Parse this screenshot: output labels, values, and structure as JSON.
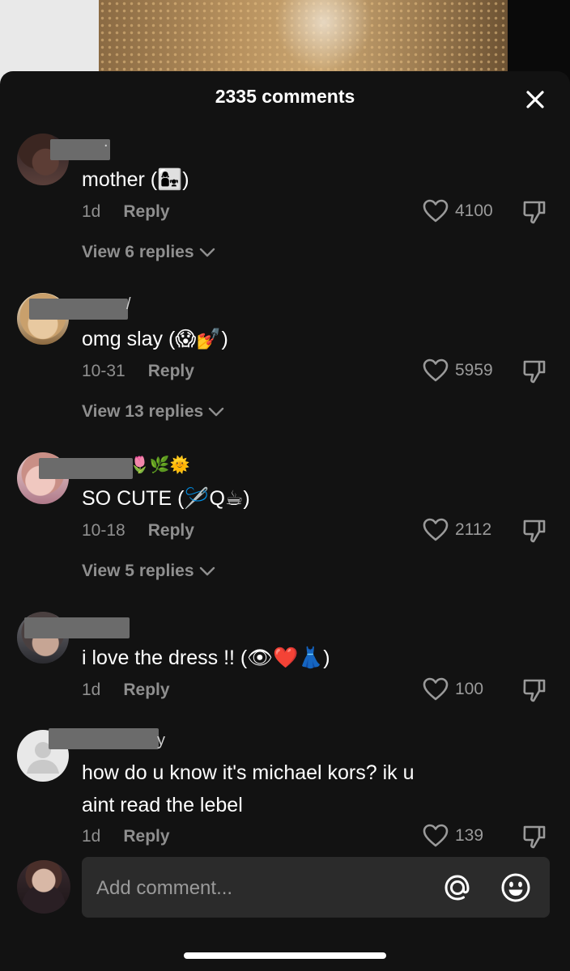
{
  "header": {
    "comment_count": "2335 comments"
  },
  "comments": [
    {
      "text": "mother (👩‍👧)",
      "date": "1d",
      "reply_label": "Reply",
      "likes": "4100",
      "view_replies": "View 6 replies",
      "name_tail": "."
    },
    {
      "text": "omg slay (😱💅)",
      "date": "10-31",
      "reply_label": "Reply",
      "likes": "5959",
      "view_replies": "View 13 replies",
      "name_tail": "/"
    },
    {
      "text": "SO CUTE (🪡Q☕)",
      "date": "10-18",
      "reply_label": "Reply",
      "likes": "2112",
      "view_replies": "View 5 replies",
      "name_tail": "🌷🌿🌞"
    },
    {
      "text": "i love the dress !! (👁❤️👗)",
      "date": "1d",
      "reply_label": "Reply",
      "likes": "100",
      "view_replies": "",
      "name_tail": ""
    },
    {
      "text_line1": "how do u know it's michael kors? ik u",
      "text_line2": "aint read the lebel",
      "date": "1d",
      "reply_label": "Reply",
      "likes": "139",
      "name_tail": "y"
    }
  ],
  "composer": {
    "placeholder": "Add comment..."
  },
  "icons": {
    "close": "close-icon",
    "like": "heart-icon",
    "dislike": "thumbs-down-icon",
    "mention": "at-icon",
    "emoji": "smiley-icon",
    "expand": "chevron-down-icon"
  },
  "colors": {
    "sheet_bg": "#121212",
    "input_bg": "#2b2b2b",
    "muted_text": "#8f8f8f",
    "redaction": "#6b6b6b"
  }
}
